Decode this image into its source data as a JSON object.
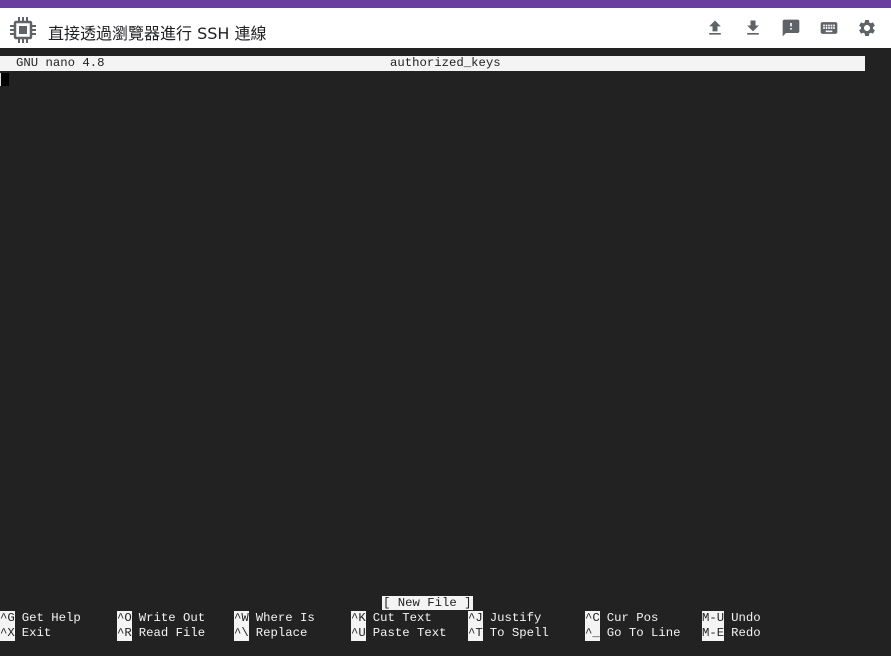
{
  "header": {
    "title": "直接透過瀏覽器進行 SSH 連線",
    "actions": [
      {
        "name": "upload",
        "icon": "upload-icon"
      },
      {
        "name": "download",
        "icon": "download-icon"
      },
      {
        "name": "feedback",
        "icon": "feedback-icon"
      },
      {
        "name": "keyboard",
        "icon": "keyboard-icon"
      },
      {
        "name": "settings",
        "icon": "gear-icon"
      }
    ]
  },
  "nano": {
    "version": "GNU nano 4.8",
    "filename": "authorized_keys",
    "status": "[ New File ]"
  },
  "shortcuts": [
    {
      "key": "^G",
      "label": "Get Help"
    },
    {
      "key": "^O",
      "label": "Write Out"
    },
    {
      "key": "^W",
      "label": "Where Is"
    },
    {
      "key": "^K",
      "label": "Cut Text"
    },
    {
      "key": "^J",
      "label": "Justify"
    },
    {
      "key": "^C",
      "label": "Cur Pos"
    },
    {
      "key": "M-U",
      "label": "Undo"
    },
    {
      "key": "^X",
      "label": "Exit"
    },
    {
      "key": "^R",
      "label": "Read File"
    },
    {
      "key": "^\\",
      "label": "Replace"
    },
    {
      "key": "^U",
      "label": "Paste Text"
    },
    {
      "key": "^T",
      "label": "To Spell"
    },
    {
      "key": "^_",
      "label": "Go To Line"
    },
    {
      "key": "M-E",
      "label": "Redo"
    }
  ],
  "colors": {
    "accent": "#6b3fa0",
    "terminal_bg": "#222222",
    "terminal_fg": "#f4f4f4"
  }
}
